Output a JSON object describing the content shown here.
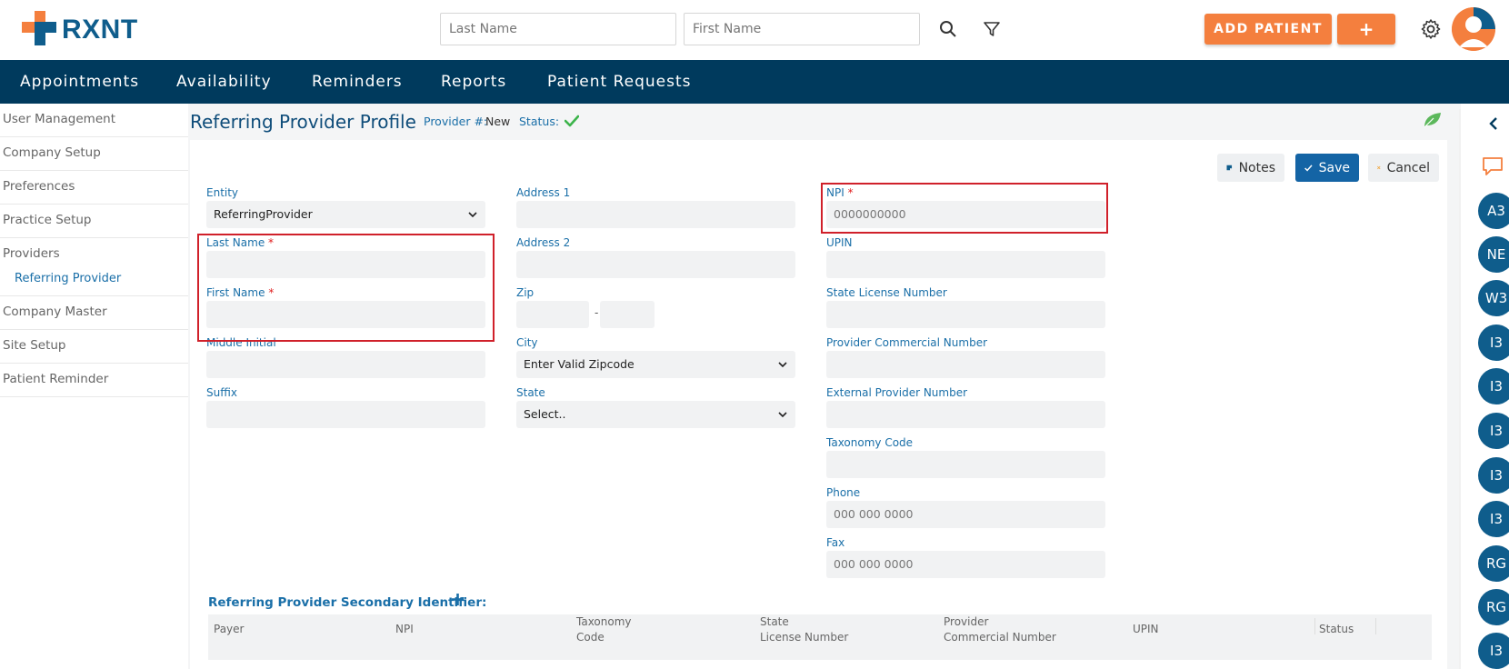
{
  "header": {
    "logo_text": "RXNT",
    "search_last_placeholder": "Last Name",
    "search_first_placeholder": "First Name",
    "add_patient_label": "ADD PATIENT",
    "add_plus_label": "+"
  },
  "nav": [
    "Appointments",
    "Availability",
    "Reminders",
    "Reports",
    "Patient Requests"
  ],
  "sidebar": {
    "items": [
      "User Management",
      "Company Setup",
      "Preferences",
      "Practice Setup",
      "Providers",
      "Company Master",
      "Site Setup",
      "Patient Reminder"
    ],
    "active_sub": "Referring Provider"
  },
  "page": {
    "title": "Referring Provider Profile",
    "provider_label": "Provider #:",
    "provider_value": "New",
    "status_label": "Status:"
  },
  "buttons": {
    "notes": "Notes",
    "save": "Save",
    "cancel": "Cancel"
  },
  "form": {
    "entity_label": "Entity",
    "entity_value": "ReferringProvider",
    "last_name_label": "Last Name",
    "first_name_label": "First Name",
    "middle_initial_label": "Middle Initial",
    "suffix_label": "Suffix",
    "address1_label": "Address 1",
    "address2_label": "Address 2",
    "zip_label": "Zip",
    "zip_sep": "-",
    "city_label": "City",
    "city_value": "Enter Valid Zipcode",
    "state_label": "State",
    "state_value": "Select..",
    "npi_label": "NPI",
    "npi_placeholder": "0000000000",
    "upin_label": "UPIN",
    "state_license_label": "State License Number",
    "provider_commercial_label": "Provider Commercial Number",
    "external_provider_label": "External Provider Number",
    "taxonomy_label": "Taxonomy Code",
    "phone_label": "Phone",
    "phone_placeholder": "000 000 0000",
    "fax_label": "Fax",
    "fax_placeholder": "000 000 0000",
    "required_mark": "*"
  },
  "secondary": {
    "title": "Referring Provider Secondary Identifier:",
    "columns": {
      "payer": "Payer",
      "npi": "NPI",
      "taxonomy_1": "Taxonomy",
      "taxonomy_2": "Code",
      "state_1": "State",
      "state_2": "License Number",
      "provider_1": "Provider",
      "provider_2": "Commercial Number",
      "upin": "UPIN",
      "status": "Status"
    }
  },
  "rail_badges": [
    "A3",
    "NE",
    "W3",
    "I3",
    "I3",
    "I3",
    "I3",
    "I3",
    "RG",
    "RG",
    "I3"
  ],
  "colors": {
    "brand": "#0f5d8c",
    "nav": "#003a5d",
    "accent": "#f47f3e",
    "link": "#1a6fa8",
    "save": "#1464a5",
    "highlight": "#d0202a"
  }
}
